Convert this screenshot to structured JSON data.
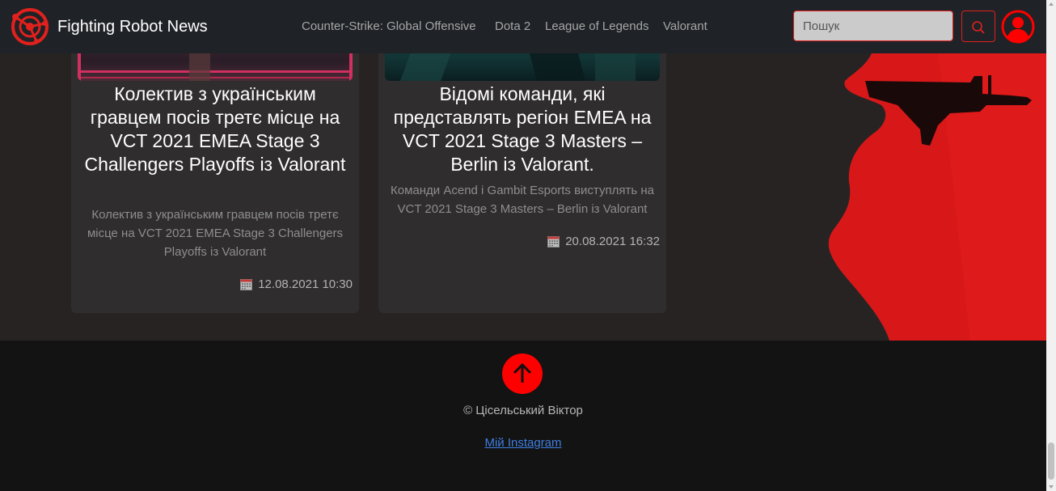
{
  "brand": {
    "name": "Fighting Robot News"
  },
  "nav": {
    "links": [
      {
        "label": "Counter-Strike: Global Offensive"
      },
      {
        "label": "Dota 2"
      },
      {
        "label": "League of Legends"
      },
      {
        "label": "Valorant"
      }
    ]
  },
  "search": {
    "placeholder": "Пошук",
    "value": ""
  },
  "articles": [
    {
      "title": "Колектив з українським гравцем посів третє місце на VCT 2021 EMEA Stage 3 Challengers Playoffs із Valorant",
      "description": "Колектив з українським гравцем посів третє місце на VCT 2021 EMEA Stage 3 Challengers Playoffs із Valorant",
      "date": "12.08.2021 10:30"
    },
    {
      "title": "Відомі команди, які представлять регіон EMEA на VCT 2021 Stage 3 Masters – Berlin із Valorant.",
      "description": "Команди Acend і Gambit Esports виступлять на VCT 2021 Stage 3 Masters – Berlin із Valorant",
      "date": "20.08.2021 16:32"
    }
  ],
  "footer": {
    "copyright": "© Цісельський Віктор",
    "instagram_label": "Мій Instagram"
  },
  "colors": {
    "accent": "#ff0000",
    "navbar_bg": "#1f2226",
    "main_bg": "#282323",
    "card_bg": "#2f2d2d",
    "footer_bg": "#131313",
    "link": "#3f7fe0"
  },
  "icons": {
    "logo": "target-logo-icon",
    "search": "search-icon",
    "user": "user-circle-icon",
    "calendar": "calendar-icon",
    "scroll_top": "arrow-up-icon"
  }
}
